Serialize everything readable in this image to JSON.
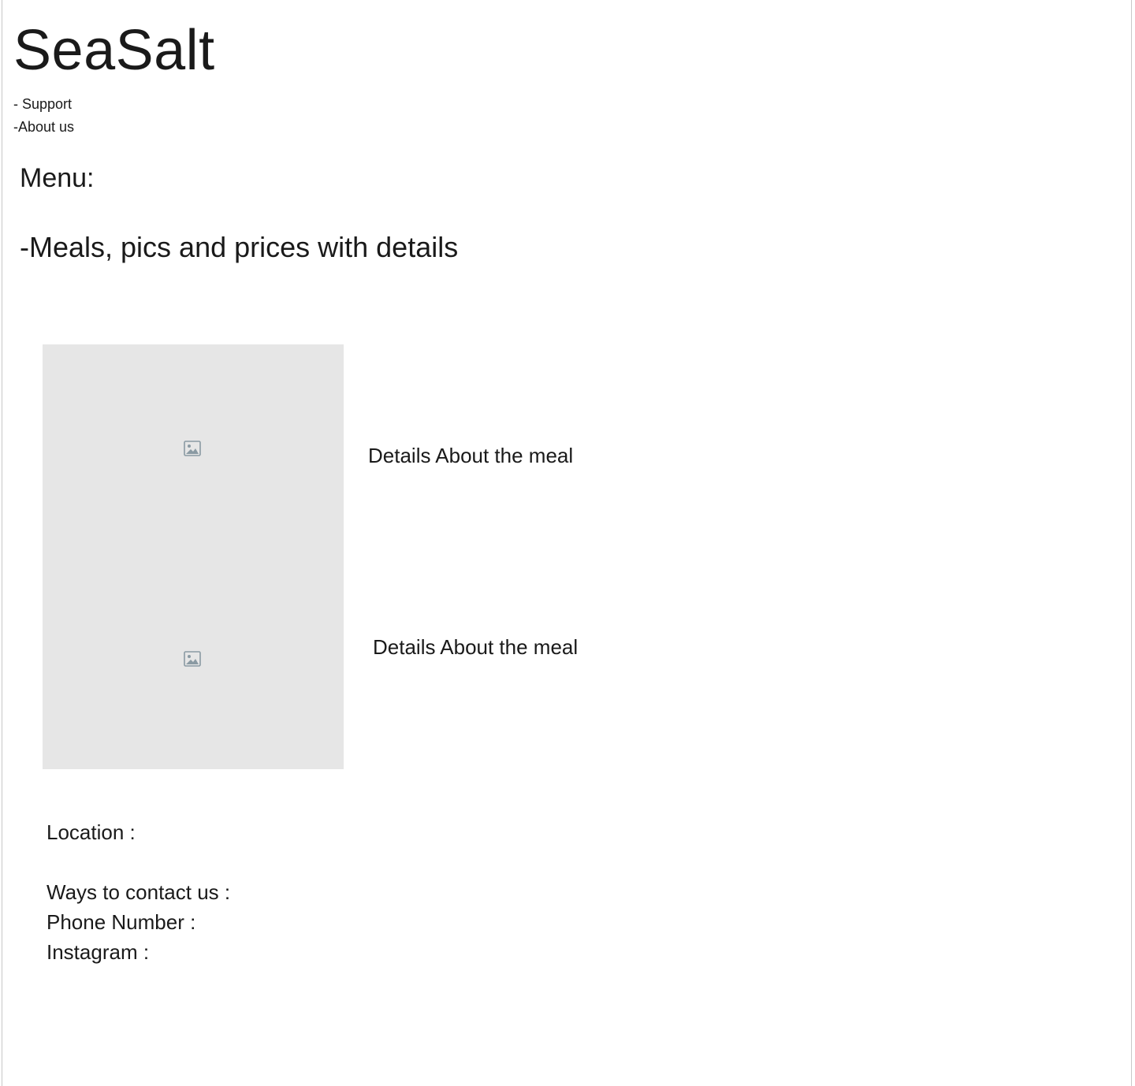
{
  "brand": {
    "name": "SeaSalt"
  },
  "nav": {
    "support": "- Support",
    "about": "-About us"
  },
  "menu": {
    "heading": "Menu:",
    "subheading": "-Meals, pics and prices with details",
    "items": [
      {
        "image_icon": "image-placeholder-icon",
        "details": "Details About the meal"
      },
      {
        "image_icon": "image-placeholder-icon",
        "details": "Details About the meal"
      }
    ]
  },
  "contact": {
    "location": "Location  :",
    "ways": "Ways to contact us :",
    "phone": "Phone Number :",
    "instagram": "Instagram :"
  },
  "colors": {
    "placeholder_bg": "#e6e6e6",
    "text": "#1a1a1a",
    "icon": "#8a9aa3"
  }
}
